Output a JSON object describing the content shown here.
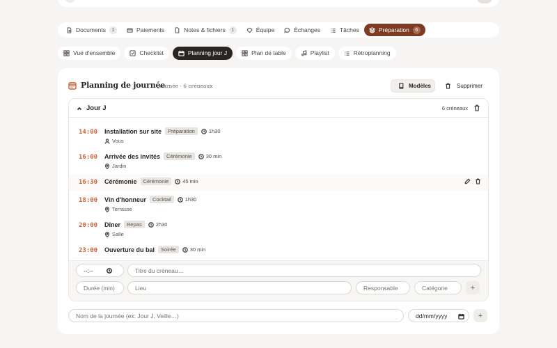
{
  "colors": {
    "accent": "#7e3b24",
    "time": "#d0633a",
    "dark_pill": "#2a2522"
  },
  "tabs": [
    {
      "label": "Documents",
      "icon": "document-icon",
      "count": "1"
    },
    {
      "label": "Paiements",
      "icon": "card-icon"
    },
    {
      "label": "Notes & fichiers",
      "icon": "note-icon",
      "count": "1"
    },
    {
      "label": "Équipe",
      "icon": "team-icon"
    },
    {
      "label": "Échanges",
      "icon": "chat-icon"
    },
    {
      "label": "Tâches",
      "icon": "list-icon"
    },
    {
      "label": "Préparation",
      "icon": "layers-icon",
      "count": "6",
      "active": true
    }
  ],
  "subtabs": [
    {
      "label": "Vue d'ensemble",
      "icon": "grid-icon"
    },
    {
      "label": "Checklist",
      "icon": "checkbox-icon"
    },
    {
      "label": "Planning jour J",
      "icon": "calendar-icon",
      "active": true
    },
    {
      "label": "Plan de table",
      "icon": "grid-icon"
    },
    {
      "label": "Playlist",
      "icon": "music-icon"
    },
    {
      "label": "Rétroplanning",
      "icon": "list-icon"
    }
  ],
  "header": {
    "title": "Planning de journée",
    "subtitle": "1 journée · 6 créneaux",
    "modeles_label": "Modèles",
    "supprimer_label": "Supprimer"
  },
  "day": {
    "name": "Jour J",
    "count": "6 créneaux",
    "slots": [
      {
        "time": "14:00",
        "title": "Installation sur site",
        "category": "Préparation",
        "duration": "1h30",
        "meta_type": "person",
        "meta": "Vous"
      },
      {
        "time": "16:00",
        "title": "Arrivée des invités",
        "category": "Cérémonie",
        "duration": "30 min",
        "meta_type": "pin",
        "meta": "Jardin"
      },
      {
        "time": "16:30",
        "title": "Cérémonie",
        "category": "Cérémonie",
        "duration": "45 min",
        "meta_type": "",
        "meta": ""
      },
      {
        "time": "18:00",
        "title": "Vin d'honneur",
        "category": "Cocktail",
        "duration": "1h30",
        "meta_type": "pin",
        "meta": "Terrasse"
      },
      {
        "time": "20:00",
        "title": "Dîner",
        "category": "Repas",
        "duration": "2h30",
        "meta_type": "pin",
        "meta": "Salle"
      },
      {
        "time": "23:00",
        "title": "Ouverture du bal",
        "category": "Soirée",
        "duration": "30 min",
        "meta_type": "",
        "meta": ""
      }
    ]
  },
  "form": {
    "time_value": "--:--",
    "title_placeholder": "Titre du créneau…",
    "duration_placeholder": "Durée (min)",
    "location_placeholder": "Lieu",
    "owner_placeholder": "Responsable",
    "category_placeholder": "Catégorie",
    "add_label": "+"
  },
  "new_day": {
    "name_placeholder": "Nom de la journée (ex: Jour J, Veille…)",
    "date_value": "dd/mm/yyyy",
    "add_label": "+"
  }
}
